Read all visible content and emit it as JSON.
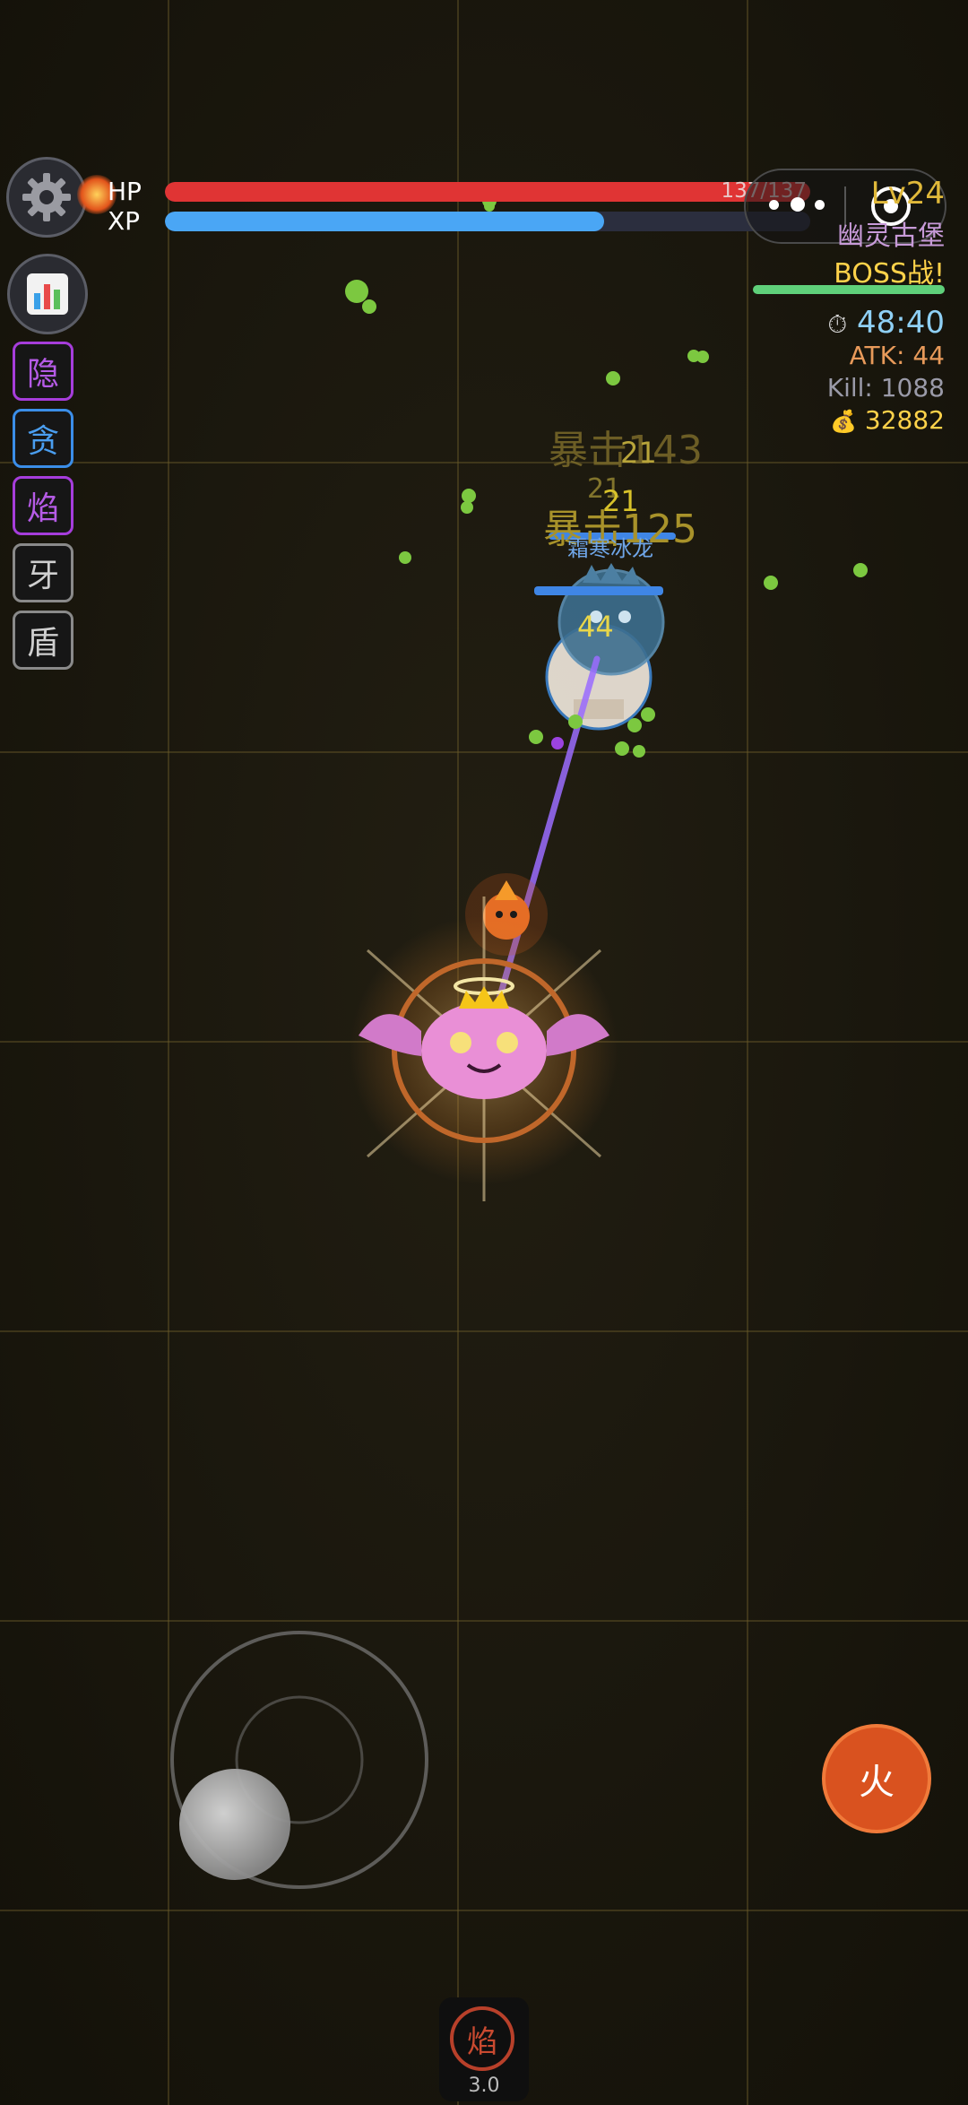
{
  "hud": {
    "hp_label": "HP",
    "xp_label": "XP",
    "hp_value": "137/137",
    "hp_fraction": 1.0,
    "xp_fraction": 0.68,
    "level": "Lv24",
    "stage_name": "幽灵古堡",
    "boss_label": "BOSS战!",
    "timer": "48:40",
    "atk": "ATK: 44",
    "kills": "Kill: 1088",
    "gold": "32882"
  },
  "icons": {
    "settings": "gear-icon",
    "stats": "bar-chart-icon",
    "timer": "stopwatch-icon",
    "gold": "money-bag-icon",
    "menu": "more-dots-icon",
    "close": "target-icon"
  },
  "skills": [
    {
      "label": "隐",
      "color": "#a63ddb"
    },
    {
      "label": "贪",
      "color": "#3b8ee8"
    },
    {
      "label": "焰",
      "color": "#a63ddb"
    },
    {
      "label": "牙",
      "color": "#8a8a8a"
    },
    {
      "label": "盾",
      "color": "#8a8a8a"
    }
  ],
  "battle": {
    "boss_name": "霜寒冰龙",
    "damage_texts": [
      "暴击143",
      "21",
      "21",
      "21",
      "暴击125",
      "44"
    ]
  },
  "controls": {
    "fire_button": "火",
    "skill_slot_label": "焰",
    "skill_slot_cooldown": "3.0"
  },
  "colors": {
    "hp": "#e03434",
    "xp": "#4aa6f5",
    "gold": "#ffd24a",
    "fire_button": "#d9521f",
    "boss_bar": "#5fd07a"
  }
}
